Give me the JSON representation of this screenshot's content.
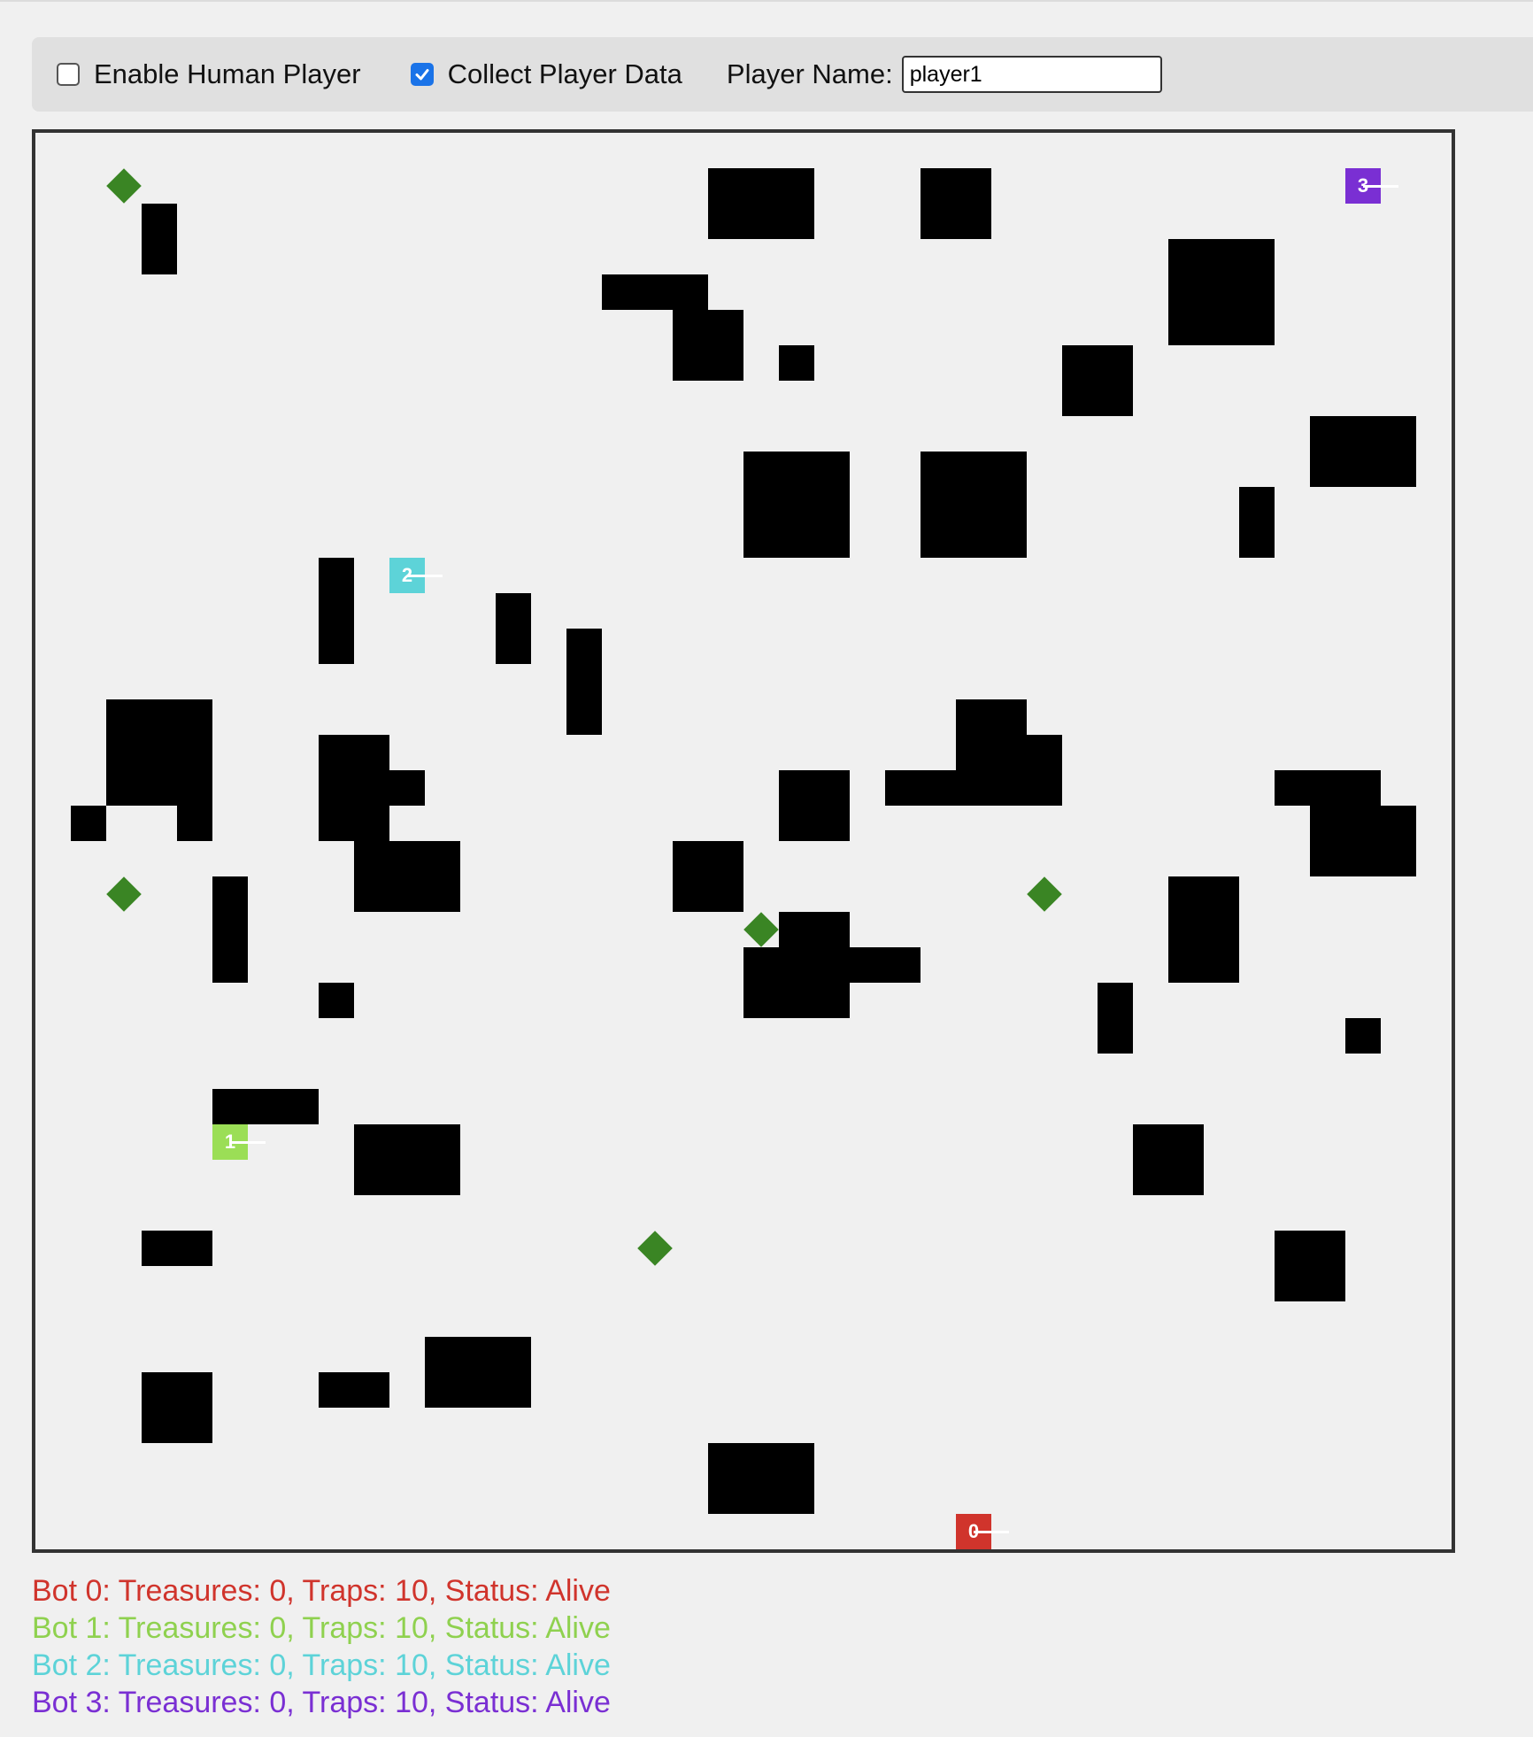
{
  "controls": {
    "human_label": "Enable Human Player",
    "human_checked": false,
    "collect_label": "Collect Player Data",
    "collect_checked": true,
    "name_label": "Player Name:",
    "name_value": "player1"
  },
  "grid": {
    "cols": 40,
    "rows": 40,
    "walls": [
      [
        3,
        2,
        1,
        2
      ],
      [
        19,
        1,
        3,
        2
      ],
      [
        25,
        1,
        2,
        2
      ],
      [
        32,
        3,
        3,
        3
      ],
      [
        16,
        4,
        3,
        1
      ],
      [
        18,
        5,
        2,
        2
      ],
      [
        21,
        6,
        1,
        1
      ],
      [
        29,
        6,
        2,
        2
      ],
      [
        36,
        8,
        3,
        2
      ],
      [
        20,
        9,
        3,
        3
      ],
      [
        25,
        9,
        3,
        3
      ],
      [
        34,
        10,
        1,
        2
      ],
      [
        8,
        12,
        1,
        3
      ],
      [
        13,
        13,
        1,
        2
      ],
      [
        15,
        14,
        1,
        3
      ],
      [
        2,
        16,
        3,
        3
      ],
      [
        1,
        19,
        1,
        1
      ],
      [
        4,
        19,
        1,
        1
      ],
      [
        8,
        17,
        2,
        3
      ],
      [
        10,
        18,
        1,
        1
      ],
      [
        9,
        20,
        3,
        2
      ],
      [
        26,
        16,
        2,
        1
      ],
      [
        26,
        17,
        3,
        1
      ],
      [
        24,
        18,
        5,
        1
      ],
      [
        21,
        18,
        2,
        2
      ],
      [
        35,
        18,
        3,
        1
      ],
      [
        36,
        19,
        3,
        2
      ],
      [
        18,
        20,
        2,
        2
      ],
      [
        5,
        21,
        1,
        3
      ],
      [
        32,
        21,
        2,
        3
      ],
      [
        21,
        22,
        2,
        1
      ],
      [
        20,
        23,
        5,
        1
      ],
      [
        20,
        24,
        3,
        1
      ],
      [
        8,
        24,
        1,
        1
      ],
      [
        30,
        24,
        1,
        2
      ],
      [
        37,
        25,
        1,
        1
      ],
      [
        5,
        27,
        3,
        1
      ],
      [
        9,
        28,
        3,
        2
      ],
      [
        31,
        28,
        2,
        2
      ],
      [
        3,
        31,
        2,
        1
      ],
      [
        35,
        31,
        2,
        2
      ],
      [
        11,
        34,
        3,
        2
      ],
      [
        8,
        35,
        2,
        1
      ],
      [
        3,
        35,
        2,
        2
      ],
      [
        19,
        37,
        3,
        2
      ]
    ],
    "treasures": [
      [
        2,
        1
      ],
      [
        2,
        21
      ],
      [
        20,
        22
      ],
      [
        28,
        21
      ],
      [
        17,
        31
      ]
    ]
  },
  "bots": [
    {
      "id": "0",
      "col": 26,
      "row": 39,
      "color": "#d0342c"
    },
    {
      "id": "1",
      "col": 5,
      "row": 28,
      "color": "#9bde56"
    },
    {
      "id": "2",
      "col": 10,
      "row": 12,
      "color": "#5dd3d8"
    },
    {
      "id": "3",
      "col": 37,
      "row": 1,
      "color": "#7a2fd3"
    }
  ],
  "stats": [
    {
      "text": "Bot 0: Treasures: 0, Traps: 10, Status: Alive",
      "color": "#d0342c"
    },
    {
      "text": "Bot 1: Treasures: 0, Traps: 10, Status: Alive",
      "color": "#8fd14f"
    },
    {
      "text": "Bot 2: Treasures: 0, Traps: 10, Status: Alive",
      "color": "#5dd3d8"
    },
    {
      "text": "Bot 3: Treasures: 0, Traps: 10, Status: Alive",
      "color": "#7a2fd3"
    }
  ]
}
